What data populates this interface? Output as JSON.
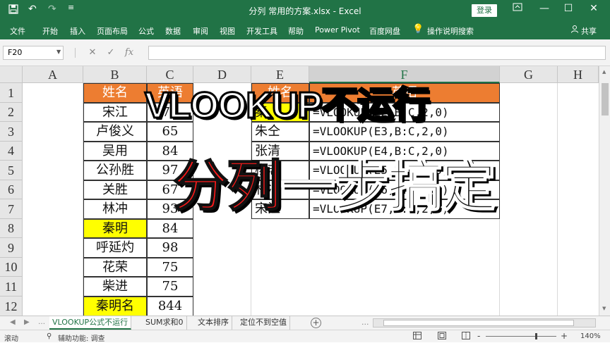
{
  "titlebar": {
    "doc_title": "分列 常用的方案.xlsx  -  Excel",
    "login_label": "登录",
    "icons": [
      "save-icon",
      "undo-icon",
      "redo-icon",
      "customize-icon"
    ],
    "window_controls": [
      "ribbon-display-icon",
      "minimize-icon",
      "maximize-icon",
      "close-icon"
    ]
  },
  "ribbon": {
    "tabs": [
      "文件",
      "开始",
      "插入",
      "页面布局",
      "公式",
      "数据",
      "审阅",
      "视图",
      "开发工具",
      "帮助",
      "Power Pivot",
      "百度网盘"
    ],
    "tell_me": "操作说明搜索",
    "share": "共享"
  },
  "formula_bar": {
    "name_box": "F20",
    "cancel_symbol": "✕",
    "enter_symbol": "✓",
    "fx_symbol": "fx",
    "formula": ""
  },
  "grid": {
    "columns": [
      "A",
      "B",
      "C",
      "D",
      "E",
      "F",
      "G",
      "H"
    ],
    "selected_column": "F",
    "rows": [
      "1",
      "2",
      "3",
      "4",
      "5",
      "6",
      "7",
      "8",
      "9",
      "10",
      "11",
      "12"
    ],
    "cells": {
      "B1": "姓名",
      "C1": "英语",
      "E1": "姓名",
      "F1": "英语",
      "B2": "宋江",
      "C2": "76",
      "E2": "秦",
      "F2": "=VLOOKUP(E2,B:C,2,0)",
      "B3": "卢俊义",
      "C3": "65",
      "E3": "朱仝",
      "F3": "=VLOOKUP(E3,B:C,2,0)",
      "B4": "吴用",
      "C4": "84",
      "E4": "张清",
      "F4": "=VLOOKUP(E4,B:C,2,0)",
      "B5": "公孙胜",
      "C5": "97",
      "E5": "杨志",
      "F5": "=VLOOKUP(E5,B:C,2,0)",
      "B6": "关胜",
      "C6": "67",
      "E6": "林冲",
      "F6": "=VLOOKUP(E6,B:C,2,0)",
      "B7": "林冲",
      "C7": "93",
      "E7": "宋江",
      "F7": "=VLOOKUP(E7,B:C,2,0)",
      "B8": "秦明",
      "C8": "84",
      "B9": "呼延灼",
      "C9": "98",
      "B10": "花荣",
      "C10": "75",
      "B11": "柴进",
      "C11": "75",
      "B12": "秦明名",
      "C12": "844"
    }
  },
  "overlay": {
    "line1_main": "VLOOKUP",
    "line1_red": "不运行",
    "line2_red": "分列",
    "line2_main": "一步搞定"
  },
  "sheets": {
    "tabs": [
      "VLOOKUP公式不运行",
      "SUM求和0",
      "文本排序",
      "定位不到空值"
    ],
    "active": "VLOOKUP公式不运行",
    "ellipsis": "..."
  },
  "statusbar": {
    "mode": "滚动",
    "accessibility": "辅助功能: 调查",
    "zoom_minus": "-",
    "zoom_plus": "+",
    "zoom": "140%"
  }
}
